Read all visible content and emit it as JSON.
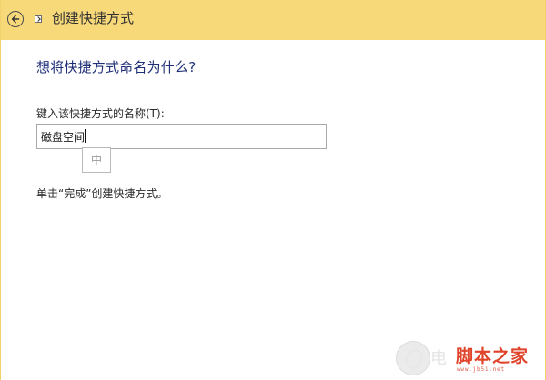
{
  "window": {
    "title": "创建快捷方式",
    "back_icon": "back-arrow-icon",
    "shortcut_icon": "shortcut-icon"
  },
  "main": {
    "heading": "想将快捷方式命名为什么?",
    "field_label": "键入该快捷方式的名称(T):",
    "shortcut_name_value": "磁盘空间",
    "ime_mode": "中",
    "hint": "单击“完成”创建快捷方式。"
  },
  "watermark": {
    "gray_text": "电",
    "brand_text": "脚本之家",
    "url": "www.jb51.net"
  },
  "colors": {
    "titlebar": "#f8d97a",
    "heading": "#1f2f78",
    "watermark_red": "#e0442a"
  }
}
